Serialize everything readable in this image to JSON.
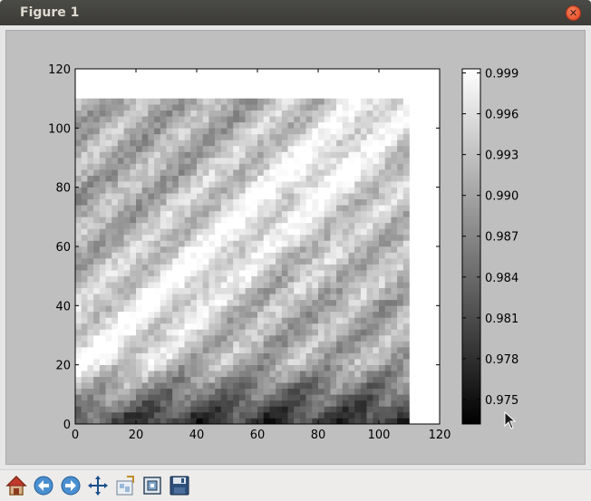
{
  "window": {
    "title": "Figure 1"
  },
  "icons": {
    "close": "close-icon",
    "home": "home-icon",
    "back": "back-arrow-icon",
    "forward": "forward-arrow-icon",
    "pan": "pan-move-icon",
    "subplots": "configure-subplots-icon",
    "zoom": "zoom-rectangle-icon",
    "save": "save-floppy-icon"
  },
  "colors": {
    "figure_bg": "#bfbfbf",
    "titlebar": "#3c3b37",
    "close_button": "#e9541f"
  },
  "chart_data": {
    "type": "heatmap",
    "colormap": "gray",
    "x_ticks": [
      "0",
      "20",
      "40",
      "60",
      "80",
      "100",
      "120"
    ],
    "y_ticks": [
      "0",
      "20",
      "40",
      "60",
      "80",
      "100",
      "120"
    ],
    "xlim": [
      0,
      120
    ],
    "ylim": [
      0,
      120
    ],
    "data_extent": [
      0,
      110,
      0,
      110
    ],
    "grid": false,
    "colorbar": {
      "ticks": [
        "0.999",
        "0.996",
        "0.993",
        "0.990",
        "0.987",
        "0.984",
        "0.981",
        "0.978",
        "0.975"
      ],
      "tick_values": [
        0.999,
        0.996,
        0.993,
        0.99,
        0.987,
        0.984,
        0.981,
        0.978,
        0.975
      ],
      "range": [
        0.9732,
        0.9993
      ]
    }
  }
}
